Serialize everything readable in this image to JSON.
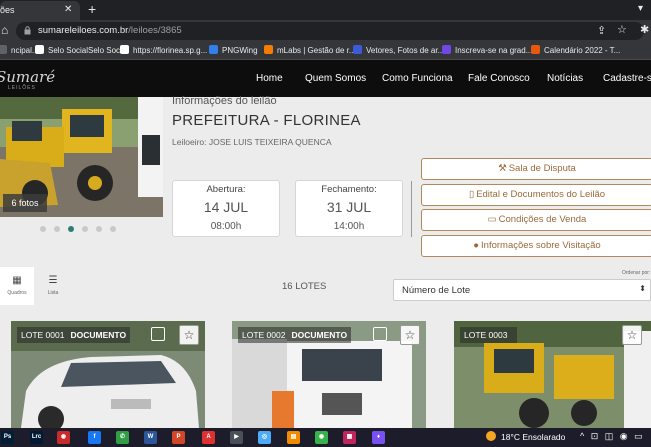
{
  "browser": {
    "tab_title": "ões",
    "new_tab": "+",
    "url_host": "sumareleiloes.com.br",
    "url_path": "/leiloes/3865",
    "bookmarks": [
      {
        "label": "ncipal...",
        "color": "#5f6368"
      },
      {
        "label": "Selo SocialSelo Social",
        "color": "#ffffff"
      },
      {
        "label": "https://florinea.sp.g...",
        "color": "#ffffff"
      },
      {
        "label": "PNGWing",
        "color": "#2f80ed"
      },
      {
        "label": "mLabs | Gestão de r...",
        "color": "#f57c00"
      },
      {
        "label": "Vetores, Fotos de ar...",
        "color": "#3b5bdb"
      },
      {
        "label": "Inscreva-se na grad...",
        "color": "#7048e8"
      },
      {
        "label": "Calendário 2022 - T...",
        "color": "#e8590c"
      }
    ]
  },
  "site": {
    "logo": "Sumaré",
    "logo_sub": "LEILÕES",
    "nav": [
      "Home",
      "Quem Somos",
      "Como Funciona",
      "Fale Conosco",
      "Notícias",
      "Cadastre-se"
    ]
  },
  "auction": {
    "info_label": "Informações do leilão",
    "title": "PREFEITURA - FLORINEA",
    "leiloeiro_label": "Leiloeiro:",
    "leiloeiro_name": "JOSE LUIS TEIXEIRA QUENCA",
    "photos_badge": "6 fotos",
    "carousel": {
      "count": 6,
      "active_index": 2
    },
    "abertura": {
      "label": "Abertura:",
      "date": "14 JUL",
      "time": "08:00h"
    },
    "fechamento": {
      "label": "Fechamento:",
      "date": "31 JUL",
      "time": "14:00h"
    },
    "actions": [
      {
        "icon": "gavel-icon",
        "glyph": "⚒",
        "label": "Sala de Disputa"
      },
      {
        "icon": "document-icon",
        "glyph": "▯",
        "label": "Edital e Documentos do Leilão"
      },
      {
        "icon": "money-icon",
        "glyph": "▭",
        "label": "Condições de Venda"
      },
      {
        "icon": "map-marker-icon",
        "glyph": "●",
        "label": "Informações sobre Visitação"
      }
    ]
  },
  "listing": {
    "view_grid": "Quadros",
    "view_list": "Lista",
    "lotes_count": "16 LOTES",
    "order_label": "Ordenar por:",
    "order_value": "Número de Lote",
    "lots": [
      {
        "number": "LOTE 0001",
        "tag": "DOCUMENTO"
      },
      {
        "number": "LOTE 0002",
        "tag": "DOCUMENTO"
      },
      {
        "number": "LOTE 0003",
        "tag": ""
      }
    ]
  },
  "taskbar": {
    "apps": [
      {
        "label": "Ps",
        "color": "#001e36"
      },
      {
        "label": "Lrc",
        "color": "#001a33"
      },
      {
        "label": "◉",
        "color": "#c92a2a"
      },
      {
        "label": "f",
        "color": "#1877f2"
      },
      {
        "label": "✆",
        "color": "#2f9e44"
      },
      {
        "label": "W",
        "color": "#2b579a"
      },
      {
        "label": "P",
        "color": "#d24726"
      },
      {
        "label": "A",
        "color": "#e03131"
      },
      {
        "label": "▶",
        "color": "#495057"
      },
      {
        "label": "◎",
        "color": "#4dabf7"
      },
      {
        "label": "▤",
        "color": "#f08c00"
      },
      {
        "label": "◉",
        "color": "#37b24d"
      },
      {
        "label": "▦",
        "color": "#c2255c"
      },
      {
        "label": "♦",
        "color": "#7950f2"
      }
    ],
    "temperature": "18°C",
    "weather": "Ensolarado"
  }
}
